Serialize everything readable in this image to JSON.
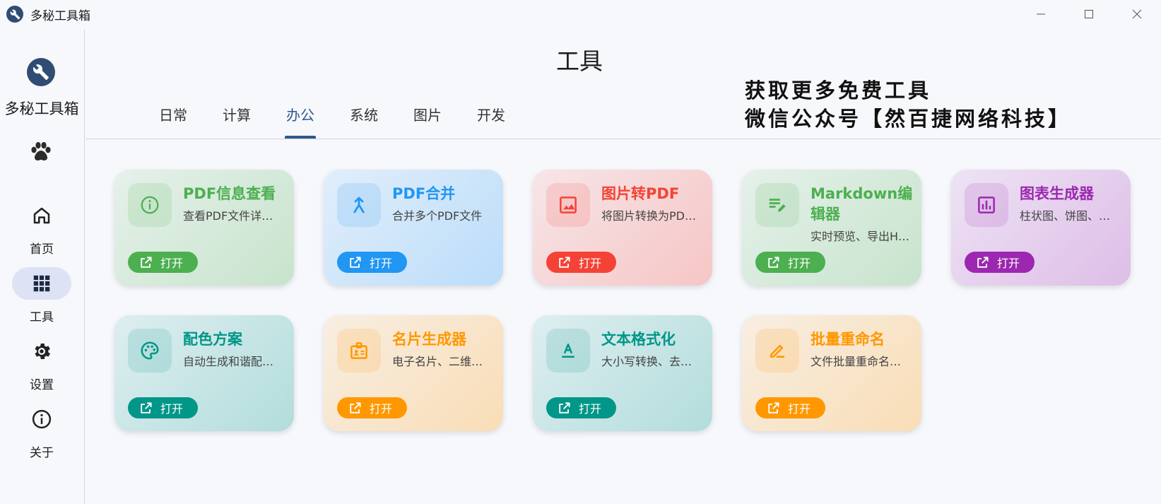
{
  "app": {
    "title": "多秘工具箱"
  },
  "window_controls": {
    "minimize_icon": "minimize-icon",
    "maximize_icon": "maximize-icon",
    "close_icon": "close-icon"
  },
  "sidebar": {
    "brand_name": "多秘工具箱",
    "items": [
      {
        "label": "首页",
        "icon": "home-icon",
        "active": false
      },
      {
        "label": "工具",
        "icon": "grid-icon",
        "active": true
      },
      {
        "label": "设置",
        "icon": "gear-icon",
        "active": false
      },
      {
        "label": "关于",
        "icon": "info-icon",
        "active": false
      }
    ]
  },
  "main": {
    "title": "工具",
    "promo_line1": "获取更多免费工具",
    "promo_line2": "微信公众号【然百捷网络科技】",
    "tabs": [
      {
        "label": "日常"
      },
      {
        "label": "计算"
      },
      {
        "label": "办公",
        "active": true
      },
      {
        "label": "系统"
      },
      {
        "label": "图片"
      },
      {
        "label": "开发"
      }
    ],
    "open_label": "打开",
    "cards": [
      {
        "title": "PDF信息查看",
        "desc": "查看PDF文件详细信息",
        "icon": "info-icon",
        "color": "#4caf50"
      },
      {
        "title": "PDF合并",
        "desc": "合并多个PDF文件",
        "icon": "merge-icon",
        "color": "#2196f3"
      },
      {
        "title": "图片转PDF",
        "desc": "将图片转换为PDF文件",
        "icon": "image-icon",
        "color": "#f44336"
      },
      {
        "title": "Markdown编辑器",
        "desc": "实时预览、导出HTML",
        "icon": "edit-note-icon",
        "color": "#4caf50"
      },
      {
        "title": "图表生成器",
        "desc": "柱状图、饼图、折线图",
        "icon": "bar-chart-icon",
        "color": "#9c27b0"
      },
      {
        "title": "配色方案",
        "desc": "自动生成和谐配色方案",
        "icon": "palette-icon",
        "color": "#009688"
      },
      {
        "title": "名片生成器",
        "desc": "电子名片、二维码名片",
        "icon": "badge-icon",
        "color": "#ff9800"
      },
      {
        "title": "文本格式化",
        "desc": "大小写转换、去除空格",
        "icon": "text-format-icon",
        "color": "#009688"
      },
      {
        "title": "批量重命名",
        "desc": "文件批量重命名工具",
        "icon": "rename-icon",
        "color": "#ff9800"
      }
    ]
  }
}
